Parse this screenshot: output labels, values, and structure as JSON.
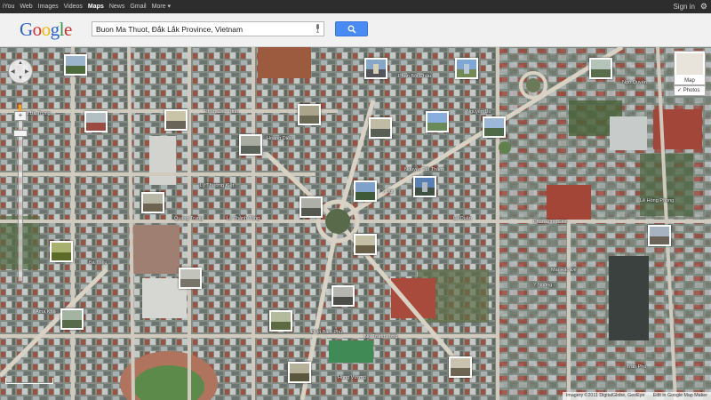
{
  "topbar": {
    "links": [
      {
        "label": "iYou",
        "active": false
      },
      {
        "label": "Web",
        "active": false
      },
      {
        "label": "Images",
        "active": false
      },
      {
        "label": "Videos",
        "active": false
      },
      {
        "label": "Maps",
        "active": true
      },
      {
        "label": "News",
        "active": false
      },
      {
        "label": "Gmail",
        "active": false
      },
      {
        "label": "More ▾",
        "active": false
      }
    ],
    "signin": "Sign in",
    "settings_icon": "gear-icon"
  },
  "header": {
    "logo": [
      "G",
      "o",
      "o",
      "g",
      "l",
      "e"
    ],
    "search_query": "Buon Ma Thuot, Đắk Lắk Province, Vietnam",
    "search_icon": "search-icon",
    "mic_icon": "microphone-icon"
  },
  "map_controls": {
    "pan_icon": "pan-control-icon",
    "pegman_icon": "pegman-icon",
    "zoom_plus": "+",
    "map_type_label": "Map",
    "photos_toggle_label": "Photos",
    "scale_label": ""
  },
  "street_labels": [
    "Hai Bà Trưng",
    "Phan Chu Trinh",
    "Quang Trung",
    "Lê Thánh Tông",
    "Lý Thường Kiệt",
    "Phan Bội Châu",
    "Ngô Quyền",
    "Y Jút",
    "Lê Duẩn",
    "Nguyễn Tất Thành",
    "Phan Đình Giót",
    "Nơ Trang Lơng",
    "Điện Biên Phủ",
    "Mai Hắc Đế",
    "Y Ngông",
    "Trần Phú",
    "Lê Hồng Phong",
    "Ama Khê",
    "Bà Triệu",
    "Hoàng Diệu",
    "Nguyễn Du",
    "Hùng Vương"
  ],
  "attribution": {
    "text": "Imagery ©2011 DigitalGlobe, GeoEye",
    "edit_link": "Edit in Google Map Maker"
  },
  "colors": {
    "topbar": "#2d2d2d",
    "search_button": "#4a8af4",
    "road": "#c9c3b8",
    "roof_red": "#a4423a",
    "vegetation": "#48603a"
  }
}
